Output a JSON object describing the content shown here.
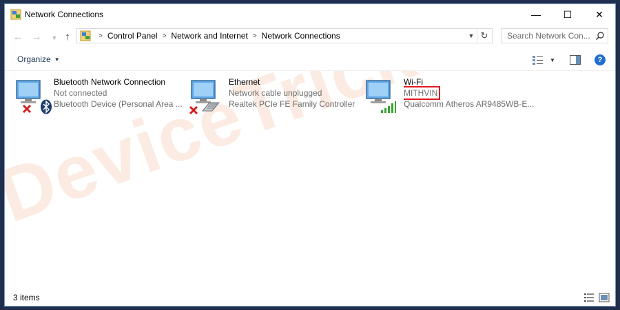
{
  "window": {
    "title": "Network Connections",
    "controls": {
      "minimize": "—",
      "maximize": "☐",
      "close": "✕"
    }
  },
  "nav": {
    "breadcrumbs": [
      "Control Panel",
      "Network and Internet",
      "Network Connections"
    ],
    "search_placeholder": "Search Network Con..."
  },
  "toolbar": {
    "organize_label": "Organize",
    "help_label": "?"
  },
  "connections": [
    {
      "name": "Bluetooth Network Connection",
      "status": "Not connected",
      "device": "Bluetooth Device (Personal Area ...",
      "icon": "monitor-icon",
      "badges": [
        "red-x-icon",
        "bluetooth-icon"
      ]
    },
    {
      "name": "Ethernet",
      "status": "Network cable unplugged",
      "device": "Realtek PCIe FE Family Controller",
      "icon": "monitor-icon",
      "badges": [
        "red-x-icon",
        "network-cable-icon"
      ]
    },
    {
      "name": "Wi-Fi",
      "status": "MITHVIN",
      "device": "Qualcomm Atheros AR9485WB-E...",
      "icon": "monitor-icon",
      "badges": [
        "wifi-signal-icon"
      ],
      "status_highlighted": true
    }
  ],
  "statusbar": {
    "item_count": "3 items"
  },
  "watermark": "DeviceTricks",
  "colors": {
    "accent": "#1f6fd0",
    "highlight_box": "#e0191f",
    "error_x": "#d21f1f",
    "signal_green": "#3aa335",
    "secondary_text": "#6d6d6d"
  }
}
